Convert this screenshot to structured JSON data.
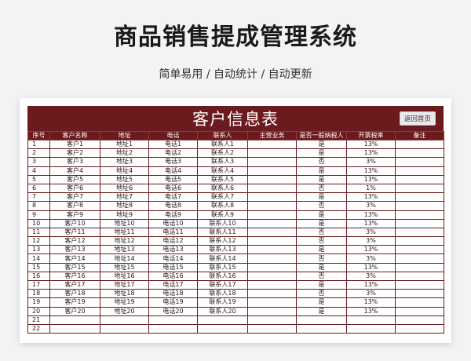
{
  "header": {
    "title": "商品销售提成管理系统",
    "subtitle": "简单易用  /  自动统计  /  自动更新"
  },
  "sheet": {
    "title": "客户信息表",
    "back_button": "返回首页",
    "columns": [
      "序号",
      "客户名称",
      "地址",
      "电话",
      "联系人",
      "主营业务",
      "是否一般纳税人",
      "开票税率",
      "备注"
    ],
    "rows": [
      [
        "1",
        "客户1",
        "地址1",
        "电话1",
        "联系人1",
        "",
        "是",
        "13%",
        ""
      ],
      [
        "2",
        "客户2",
        "地址2",
        "电话2",
        "联系人2",
        "",
        "是",
        "13%",
        ""
      ],
      [
        "3",
        "客户3",
        "地址3",
        "电话3",
        "联系人3",
        "",
        "否",
        "3%",
        ""
      ],
      [
        "4",
        "客户4",
        "地址4",
        "电话4",
        "联系人4",
        "",
        "是",
        "13%",
        ""
      ],
      [
        "5",
        "客户5",
        "地址5",
        "电话5",
        "联系人5",
        "",
        "是",
        "13%",
        ""
      ],
      [
        "6",
        "客户6",
        "地址6",
        "电话6",
        "联系人6",
        "",
        "否",
        "1%",
        ""
      ],
      [
        "7",
        "客户7",
        "地址7",
        "电话7",
        "联系人7",
        "",
        "是",
        "13%",
        ""
      ],
      [
        "8",
        "客户8",
        "地址8",
        "电话8",
        "联系人8",
        "",
        "否",
        "3%",
        ""
      ],
      [
        "9",
        "客户9",
        "地址9",
        "电话9",
        "联系人9",
        "",
        "是",
        "13%",
        ""
      ],
      [
        "10",
        "客户10",
        "地址10",
        "电话10",
        "联系人10",
        "",
        "是",
        "13%",
        ""
      ],
      [
        "11",
        "客户11",
        "地址11",
        "电话11",
        "联系人11",
        "",
        "否",
        "3%",
        ""
      ],
      [
        "12",
        "客户12",
        "地址12",
        "电话12",
        "联系人12",
        "",
        "否",
        "3%",
        ""
      ],
      [
        "13",
        "客户13",
        "地址13",
        "电话13",
        "联系人13",
        "",
        "是",
        "13%",
        ""
      ],
      [
        "14",
        "客户14",
        "地址14",
        "电话14",
        "联系人14",
        "",
        "否",
        "3%",
        ""
      ],
      [
        "15",
        "客户15",
        "地址15",
        "电话15",
        "联系人15",
        "",
        "是",
        "13%",
        ""
      ],
      [
        "16",
        "客户16",
        "地址16",
        "电话16",
        "联系人16",
        "",
        "否",
        "3%",
        ""
      ],
      [
        "17",
        "客户17",
        "地址17",
        "电话17",
        "联系人17",
        "",
        "是",
        "13%",
        ""
      ],
      [
        "18",
        "客户18",
        "地址18",
        "电话18",
        "联系人18",
        "",
        "否",
        "3%",
        ""
      ],
      [
        "19",
        "客户19",
        "地址19",
        "电话19",
        "联系人19",
        "",
        "是",
        "13%",
        ""
      ],
      [
        "20",
        "客户20",
        "地址20",
        "电话20",
        "联系人20",
        "",
        "是",
        "13%",
        ""
      ],
      [
        "21",
        "",
        "",
        "",
        "",
        "",
        "",
        "",
        ""
      ],
      [
        "22",
        "",
        "",
        "",
        "",
        "",
        "",
        "",
        ""
      ]
    ]
  },
  "colors": {
    "accent": "#6b1a1d",
    "background": "#f2f3f5"
  }
}
